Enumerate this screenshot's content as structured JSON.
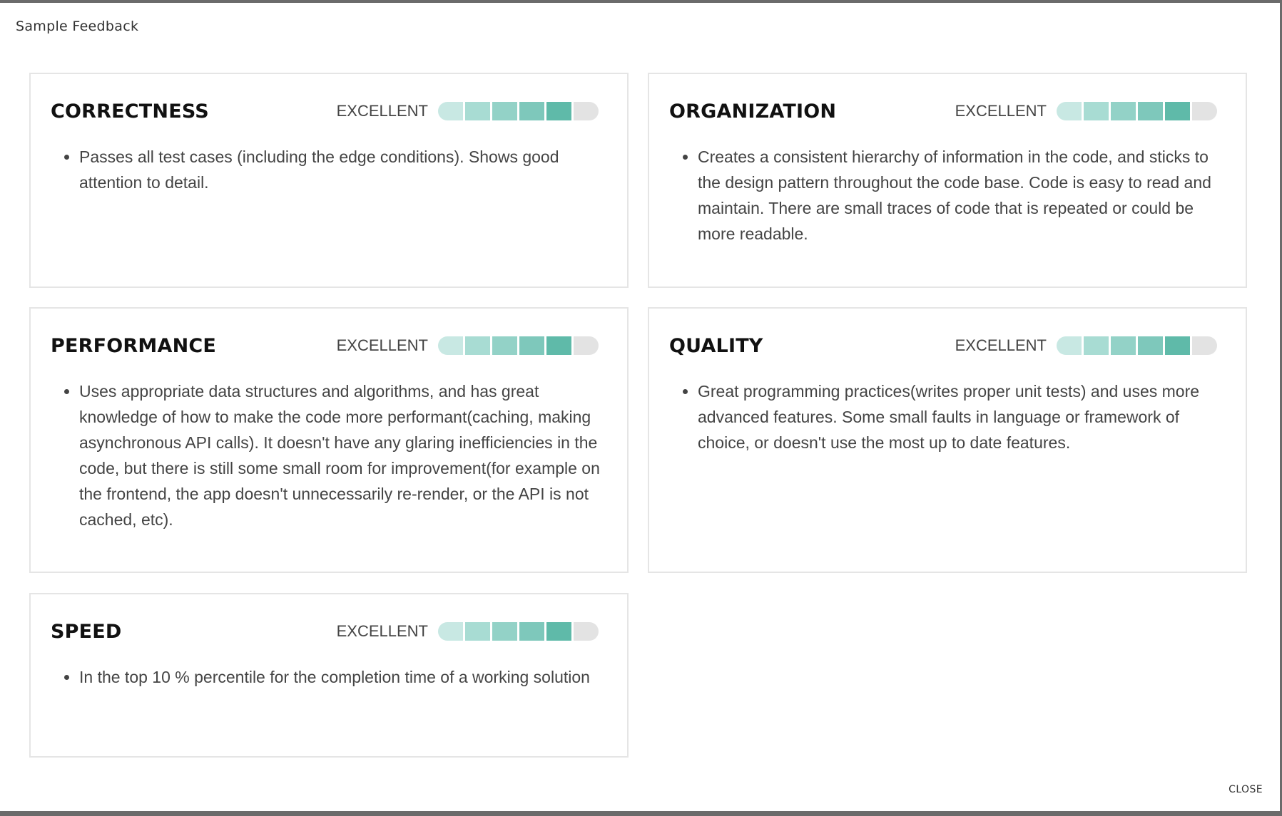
{
  "dialog": {
    "title": "Sample Feedback",
    "close_label": "CLOSE"
  },
  "rating_colors": [
    "#c8e8e3",
    "#a8dcd3",
    "#93d2c7",
    "#7ec8bb",
    "#5fbaa9",
    "#e3e3e3"
  ],
  "cards": [
    {
      "title": "CORRECTNESS",
      "rating_label": "EXCELLENT",
      "rating_filled": 5,
      "rating_total": 6,
      "bullets": [
        "Passes all test cases (including the edge conditions). Shows good attention to detail."
      ]
    },
    {
      "title": "ORGANIZATION",
      "rating_label": "EXCELLENT",
      "rating_filled": 5,
      "rating_total": 6,
      "bullets": [
        "Creates a consistent hierarchy of information in the code, and sticks to the design pattern throughout the code base. Code is easy to read and maintain. There are small traces of code that is repeated or could be more readable."
      ]
    },
    {
      "title": "PERFORMANCE",
      "rating_label": "EXCELLENT",
      "rating_filled": 5,
      "rating_total": 6,
      "bullets": [
        "Uses appropriate data structures and algorithms, and has great knowledge of how to make the code more performant(caching, making asynchronous API calls). It doesn't have any glaring inefficiencies in the code, but there is still some small room for improvement(for example on the frontend, the app doesn't unnecessarily re-render, or the API is not cached, etc)."
      ]
    },
    {
      "title": "QUALITY",
      "rating_label": "EXCELLENT",
      "rating_filled": 5,
      "rating_total": 6,
      "bullets": [
        "Great programming practices(writes proper unit tests) and uses more advanced features. Some small faults in language or framework of choice, or doesn't use the most up to date features."
      ]
    },
    {
      "title": "SPEED",
      "rating_label": "EXCELLENT",
      "rating_filled": 5,
      "rating_total": 6,
      "bullets": [
        "In the top 10 % percentile for the completion time of a working solution"
      ]
    }
  ]
}
